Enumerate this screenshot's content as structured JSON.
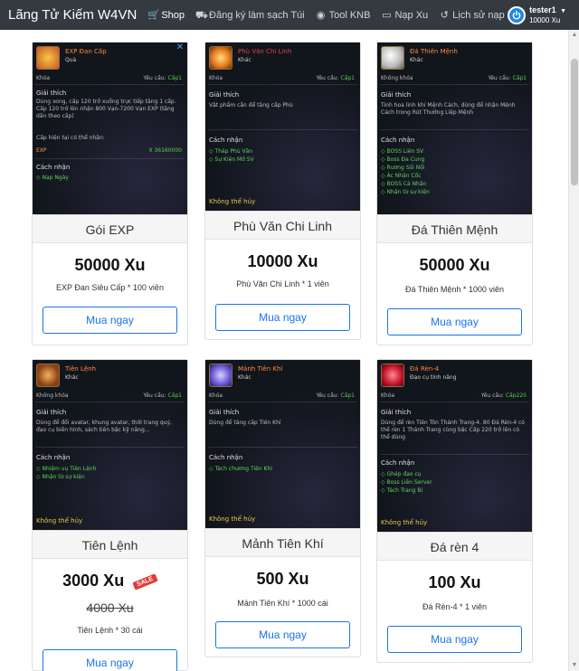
{
  "app": {
    "brand": "Lãng Tử Kiếm W4VN",
    "nav": [
      {
        "label": "Shop",
        "icon": "cart-icon"
      },
      {
        "label": "Đăng ký làm sạch Túi",
        "icon": "car-icon"
      },
      {
        "label": "Tool KNB",
        "icon": "globe-icon"
      },
      {
        "label": "Nạp Xu",
        "icon": "money-icon"
      },
      {
        "label": "Lịch sử nạp Xu",
        "icon": "history-icon"
      }
    ],
    "user": {
      "name": "tester1",
      "balance": "10000 Xu"
    }
  },
  "buy_label": "Mua ngay",
  "products": [
    {
      "name": "Gói EXP",
      "price": "50000 Xu",
      "desc": "EXP Đan Siêu Cấp * 100 viên",
      "tip": {
        "name": "EXP Đan Cấp",
        "type": "Quà",
        "lock": "Khóa",
        "req_label": "Yêu cầu:",
        "req": "Cấp1",
        "desc_title": "Giải thích",
        "desc": "Dùng xong, cấp 120 trở xuống trực tiếp tăng 1 cấp. Cấp 120 trở lên nhận 800 Vạn-7200 Vạn EXP (tăng dần theo cấp)",
        "extra": "Cấp hiện tại có thể nhận:",
        "exp_label": "EXP",
        "exp_value": "X 36160000",
        "source_title": "Cách nhận",
        "sources": [
          "Nạp Ngày"
        ],
        "icon_color": "#e0632a"
      }
    },
    {
      "name": "Phù Văn Chi Linh",
      "price": "10000 Xu",
      "desc": "Phù Văn Chi Linh * 1 viên",
      "tip": {
        "name": "Phù Văn Chi Linh",
        "type": "Khác",
        "lock": "Khóa",
        "req_label": "Yêu cầu:",
        "req": "Cấp1",
        "desc_title": "Giải thích",
        "desc": "Vật phẩm cần để tăng cấp Phù",
        "source_title": "Cách nhận",
        "sources": [
          "Tháp Phù Văn",
          "Sự Kiện Mở SV"
        ],
        "foot": "Không thể hủy",
        "icon_color": "#f0a21e"
      }
    },
    {
      "name": "Đá Thiên Mệnh",
      "price": "50000 Xu",
      "desc": "Đá Thiên Mệnh * 1000 viên",
      "tip": {
        "name": "Đá Thiên Mệnh",
        "type": "Khác",
        "lock": "Không khóa",
        "req_label": "Yêu cầu:",
        "req": "Cấp1",
        "desc_title": "Giải thích",
        "desc": "Tinh hoa linh khí Mệnh Cách, dùng để nhận Mệnh Cách trong Rút Thưởng Liệp Mệnh",
        "source_title": "Cách nhận",
        "sources": [
          "BOSS Liên SV",
          "Boss Đa Cung",
          "Rương Sối Nổi",
          "Ác Nhân Cốc",
          "BOSS Cá Nhân",
          "Nhận từ sự kiện"
        ],
        "icon_color": "#d8d8d8"
      }
    },
    {
      "name": "Tiên Lệnh",
      "price": "3000 Xu",
      "old_price": "4000 Xu",
      "sale": "SALE",
      "desc": "Tiên Lệnh * 30 cái",
      "tip": {
        "name": "Tiên Lệnh",
        "type": "Khác",
        "lock": "Không khóa",
        "req_label": "Yêu cầu:",
        "req": "Cấp1",
        "desc_title": "Giải thích",
        "desc": "Dùng để đổi avatar, khung avatar, thời trang quý, đạo cụ biến hình, sách tiên bậc kỹ năng...",
        "source_title": "Cách nhận",
        "sources": [
          "Nhiệm vụ Tiên Lệnh",
          "Nhận từ sự kiện"
        ],
        "foot": "Không thể hủy",
        "icon_color": "#b5651d"
      }
    },
    {
      "name": "Mảnh Tiên Khí",
      "price": "500 Xu",
      "desc": "Mảnh Tiên Khí * 1000 cái",
      "tip": {
        "name": "Mảnh Tiên Khí",
        "type": "Khác",
        "lock": "Khóa",
        "req_label": "Yêu cầu:",
        "req": "Cấp1",
        "desc_title": "Giải thích",
        "desc": "Dùng để tăng cấp Tiên Khí",
        "source_title": "Cách nhận",
        "sources": [
          "Tách chương Tiên Khí"
        ],
        "foot": "Không thể hủy",
        "icon_color": "#7a6ad8"
      }
    },
    {
      "name": "Đá rèn 4",
      "price": "100 Xu",
      "desc": "Đá Rèn-4 * 1 viên",
      "tip": {
        "name": "Đá Rèn-4",
        "type": "Đạo cụ tính năng",
        "lock": "Khóa",
        "req_label": "Yêu cầu:",
        "req": "Cấp220",
        "desc_title": "Giải thích",
        "desc": "Dùng để rèn Tiên Tôn Thánh Trang-4. 80 Đá Rèn-4 có thể rèn 1 Thánh Trang cùng bậc Cấp 220 trở lên có thể dùng",
        "source_title": "Cách nhận",
        "sources": [
          "Ghép đạo cụ",
          "Boss Liên Server",
          "Tách Trang Bị"
        ],
        "foot": "Không thể hủy",
        "icon_color": "#d8283a"
      }
    }
  ]
}
